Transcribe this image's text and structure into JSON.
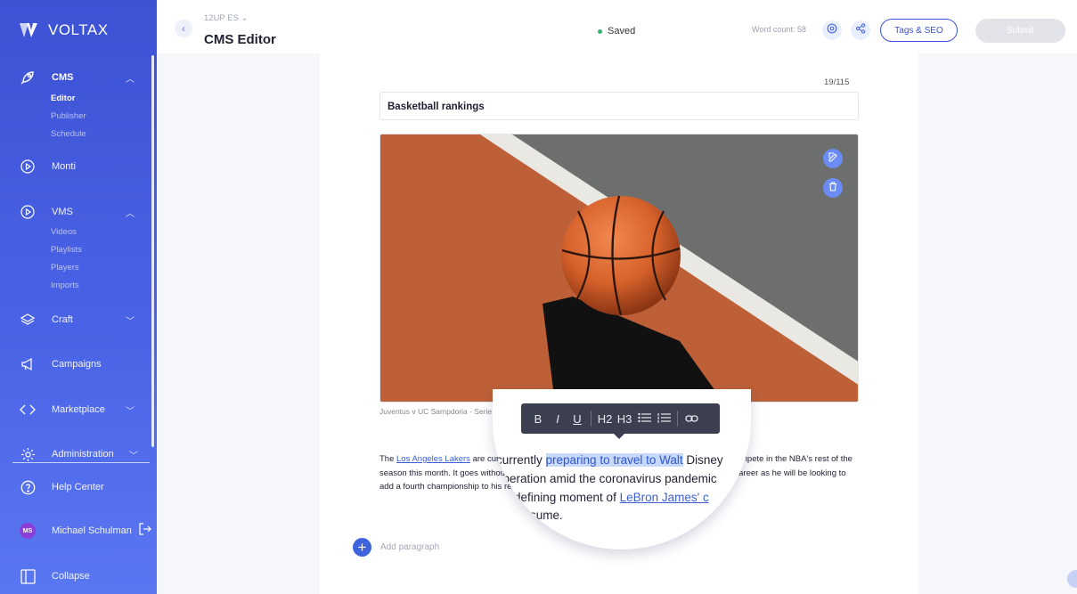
{
  "brand": {
    "name": "VOLTAX"
  },
  "sidebar": {
    "cms": {
      "label": "CMS",
      "items": [
        "Editor",
        "Publisher",
        "Schedule"
      ]
    },
    "monti": {
      "label": "Monti"
    },
    "vms": {
      "label": "VMS",
      "items": [
        "Videos",
        "Playlists",
        "Players",
        "Imports"
      ]
    },
    "craft": {
      "label": "Craft"
    },
    "campaigns": {
      "label": "Campaigns"
    },
    "marketplace": {
      "label": "Marketplace"
    },
    "administration": {
      "label": "Administration"
    },
    "help": {
      "label": "Help Center"
    },
    "user": {
      "initials": "MS",
      "name": "Michael Schulman"
    },
    "collapse": {
      "label": "Collapse"
    }
  },
  "header": {
    "site": "12UP ES",
    "title": "CMS Editor",
    "status": "Saved",
    "word_count": "Word count: 58",
    "tags_label": "Tags & SEO",
    "submit_label": "Submit"
  },
  "editor": {
    "char_count": "19/115",
    "title_value": "Basketball rankings",
    "caption": "Juventus v UC Sampdoria - Serie A",
    "body_p1": "The ",
    "body_link1": "Los Angeles Lakers",
    "body_p2": " are currently preparing to travel to Walt Disney World where they will compete in the NBA's rest of the season this month. It goes without saying that this will be a defining moment of LeBron James' career as he will be looking to add a fourth championship to his resume.",
    "add_paragraph": "Add paragraph"
  },
  "magnifier": {
    "line1_a": "currently ",
    "line1_hl": "preparing to travel to Walt",
    "line1_b": " Disney",
    "line2": "operation amid the coronavirus pandemic",
    "line3_a": "defining moment of ",
    "line3_link": "LeBron James' c",
    "line4": "sume."
  },
  "toolbar": {
    "bold": "B",
    "italic": "I",
    "underline": "U",
    "h2": "H2",
    "h3": "H3"
  },
  "colors": {
    "sidebar": "#3d52d5",
    "accent": "#3a52d8",
    "saved": "#2fb46b",
    "highlight": "#c7d8fb"
  }
}
